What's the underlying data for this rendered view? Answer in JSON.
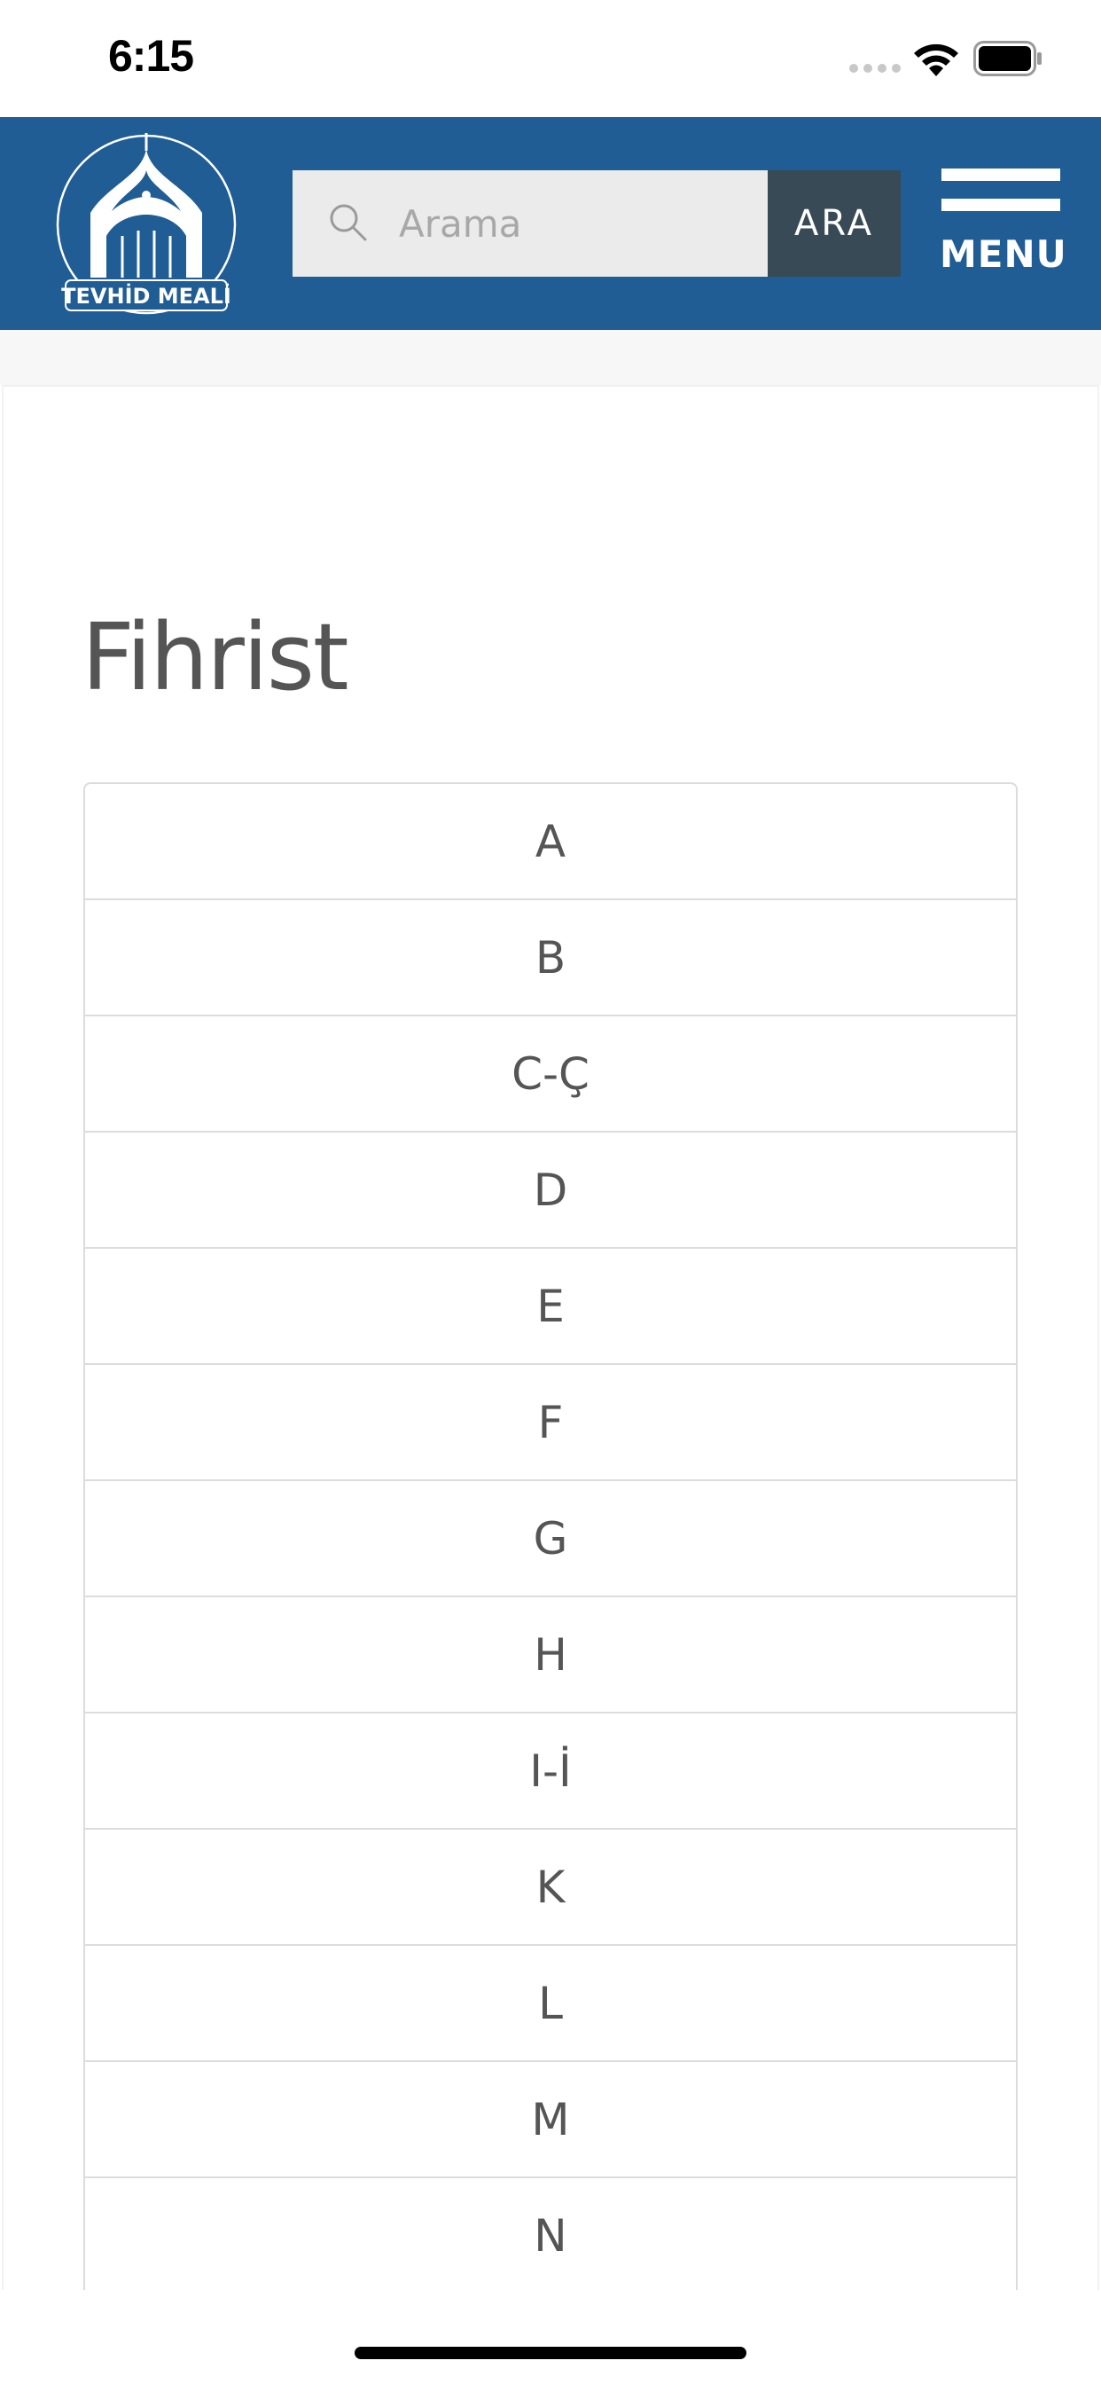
{
  "status_bar": {
    "time": "6:15"
  },
  "header": {
    "logo_text": "TEVHİD MEALİ",
    "search": {
      "placeholder": "Arama",
      "value": ""
    },
    "search_button_label": "ARA",
    "menu_label": "MENU",
    "colors": {
      "header_bg": "#1f5d94",
      "search_button_bg": "#374a55"
    }
  },
  "main": {
    "title": "Fihrist",
    "index_items": [
      "A",
      "B",
      "C-Ç",
      "D",
      "E",
      "F",
      "G",
      "H",
      "I-İ",
      "K",
      "L",
      "M",
      "N"
    ]
  }
}
